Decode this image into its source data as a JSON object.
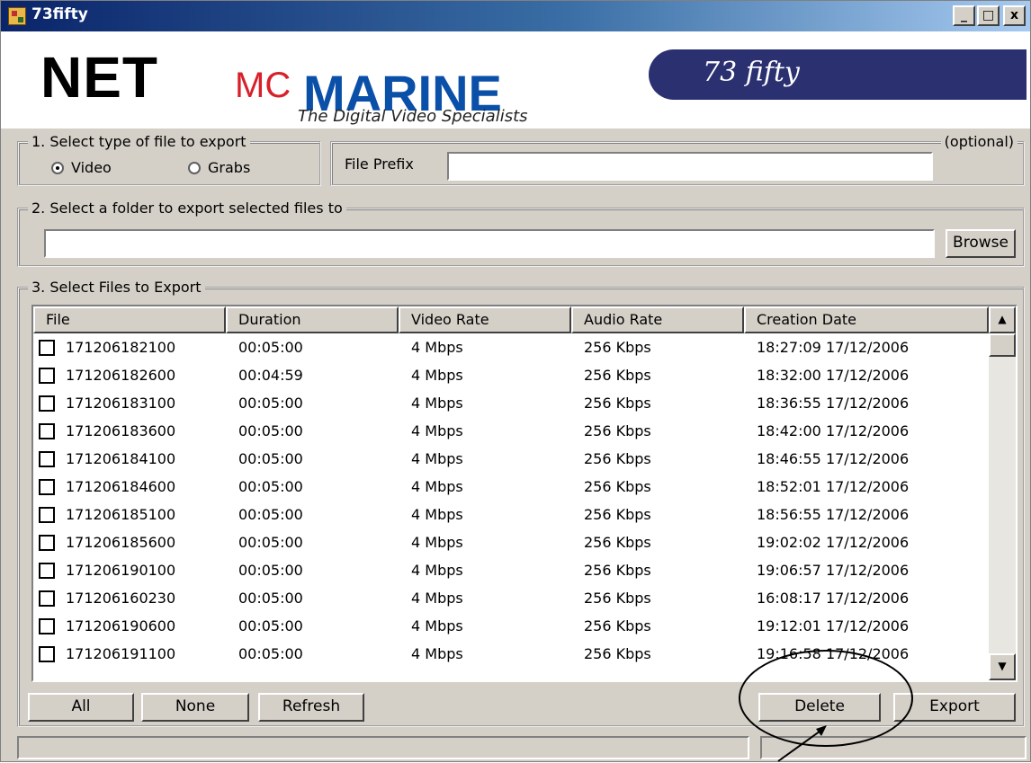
{
  "window": {
    "title": "73fifty",
    "controls": {
      "minimize": "_",
      "maximize": "□",
      "close": "x"
    }
  },
  "header": {
    "logo_net": "NET",
    "logo_mc": "MC",
    "logo_marine": "MARINE",
    "tagline": "The Digital Video Specialists",
    "badge": "73 fifty"
  },
  "section1": {
    "legend": "1. Select type of file to export",
    "options": [
      {
        "label": "Video",
        "checked": true
      },
      {
        "label": "Grabs",
        "checked": false
      }
    ]
  },
  "prefix": {
    "legend": "(optional)",
    "label": "File Prefix",
    "value": ""
  },
  "section2": {
    "legend": "2. Select a folder to export selected files to",
    "path_value": "",
    "browse_label": "Browse"
  },
  "section3": {
    "legend": "3. Select Files to Export",
    "columns": [
      "File",
      "Duration",
      "Video Rate",
      "Audio Rate",
      "Creation Date"
    ],
    "rows": [
      {
        "file": "171206182100",
        "duration": "00:05:00",
        "video_rate": "4 Mbps",
        "audio_rate": "256 Kbps",
        "created": "18:27:09 17/12/2006"
      },
      {
        "file": "171206182600",
        "duration": "00:04:59",
        "video_rate": "4 Mbps",
        "audio_rate": "256 Kbps",
        "created": "18:32:00 17/12/2006"
      },
      {
        "file": "171206183100",
        "duration": "00:05:00",
        "video_rate": "4 Mbps",
        "audio_rate": "256 Kbps",
        "created": "18:36:55 17/12/2006"
      },
      {
        "file": "171206183600",
        "duration": "00:05:00",
        "video_rate": "4 Mbps",
        "audio_rate": "256 Kbps",
        "created": "18:42:00 17/12/2006"
      },
      {
        "file": "171206184100",
        "duration": "00:05:00",
        "video_rate": "4 Mbps",
        "audio_rate": "256 Kbps",
        "created": "18:46:55 17/12/2006"
      },
      {
        "file": "171206184600",
        "duration": "00:05:00",
        "video_rate": "4 Mbps",
        "audio_rate": "256 Kbps",
        "created": "18:52:01 17/12/2006"
      },
      {
        "file": "171206185100",
        "duration": "00:05:00",
        "video_rate": "4 Mbps",
        "audio_rate": "256 Kbps",
        "created": "18:56:55 17/12/2006"
      },
      {
        "file": "171206185600",
        "duration": "00:05:00",
        "video_rate": "4 Mbps",
        "audio_rate": "256 Kbps",
        "created": "19:02:02 17/12/2006"
      },
      {
        "file": "171206190100",
        "duration": "00:05:00",
        "video_rate": "4 Mbps",
        "audio_rate": "256 Kbps",
        "created": "19:06:57 17/12/2006"
      },
      {
        "file": "171206160230",
        "duration": "00:05:00",
        "video_rate": "4 Mbps",
        "audio_rate": "256 Kbps",
        "created": "16:08:17 17/12/2006"
      },
      {
        "file": "171206190600",
        "duration": "00:05:00",
        "video_rate": "4 Mbps",
        "audio_rate": "256 Kbps",
        "created": "19:12:01 17/12/2006"
      },
      {
        "file": "171206191100",
        "duration": "00:05:00",
        "video_rate": "4 Mbps",
        "audio_rate": "256 Kbps",
        "created": "19:16:58 17/12/2006"
      }
    ]
  },
  "buttons": {
    "all": "All",
    "none": "None",
    "refresh": "Refresh",
    "delete": "Delete",
    "export": "Export"
  },
  "colors": {
    "titlebar_start": "#0a246a",
    "face": "#d4d0c8",
    "logo_red": "#d8202a",
    "logo_blue": "#0a4fa8",
    "badge_bg": "#2a3070"
  },
  "icons": [
    "app-icon",
    "scroll-up-icon",
    "scroll-down-icon",
    "checkbox-icon"
  ]
}
